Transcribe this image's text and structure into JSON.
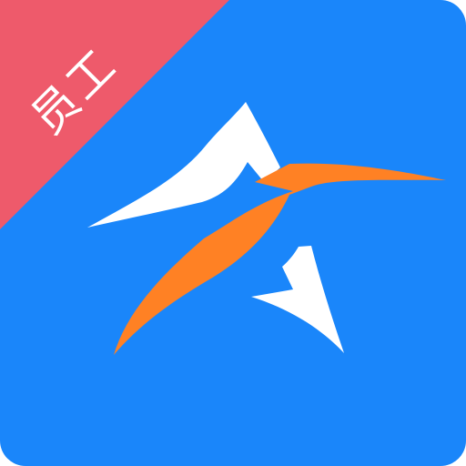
{
  "icon": {
    "background_color": "#1A86FA",
    "logo_primary_color": "#FFFFFF",
    "logo_accent_color": "#FF8124",
    "logo_name": "star-swoosh-logo"
  },
  "ribbon": {
    "label": "员工",
    "color": "#EE5A6B",
    "text_color": "#FFFFFF"
  }
}
